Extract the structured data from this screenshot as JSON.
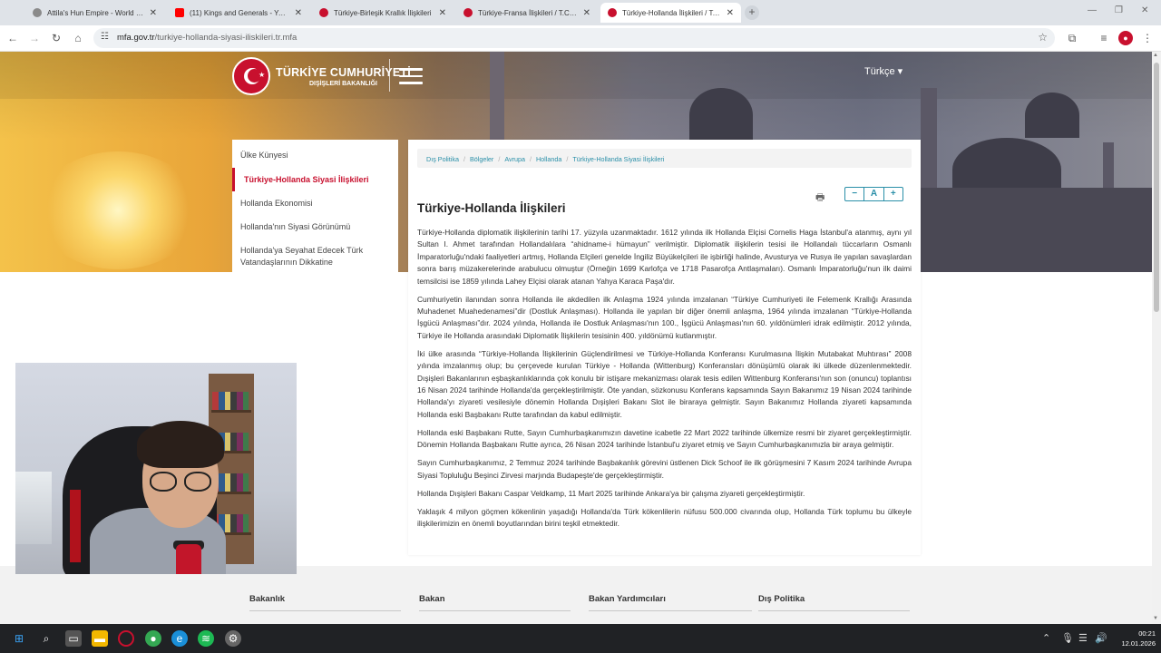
{
  "browser": {
    "tabs": [
      {
        "title": "Attila's Hun Empire - World His",
        "icon": "globe-icon",
        "color": "#8a8a8a",
        "active": false
      },
      {
        "title": "(11) Kings and Generals - YouTube",
        "icon": "youtube-icon",
        "color": "#ff0000",
        "active": false
      },
      {
        "title": "Türkiye-Birleşik Krallık İlişkileri",
        "icon": "mfa-icon",
        "color": "#c8102e",
        "active": false
      },
      {
        "title": "Türkiye-Fransa İlişkileri / T.C. D",
        "icon": "mfa-icon",
        "color": "#c8102e",
        "active": false
      },
      {
        "title": "Türkiye-Hollanda İlişkileri / T.C.",
        "icon": "mfa-icon",
        "color": "#c8102e",
        "active": true
      }
    ],
    "url_host": "mfa.gov.tr",
    "url_path": "/turkiye-hollanda-siyasi-iliskileri.tr.mfa"
  },
  "header": {
    "logo_line1": "TÜRKİYE CUMHURİYETİ",
    "logo_line2": "DIŞİŞLERİ BAKANLIĞI",
    "language": "Türkçe ▾"
  },
  "sidebar": {
    "items": [
      {
        "label": "Ülke Künyesi",
        "active": false
      },
      {
        "label": "Türkiye-Hollanda Siyasi İlişkileri",
        "active": true
      },
      {
        "label": "Hollanda Ekonomisi",
        "active": false
      },
      {
        "label": "Hollanda'nın Siyasi Görünümü",
        "active": false
      },
      {
        "label": "Hollanda'ya Seyahat Edecek Türk Vatandaşlarının Dikkatine",
        "active": false
      }
    ]
  },
  "breadcrumb": [
    "Dış Politika",
    "Bölgeler",
    "Avrupa",
    "Hollanda",
    "Türkiye-Hollanda Siyasi İlişkileri"
  ],
  "tools": {
    "decrease": "−",
    "reset": "A",
    "increase": "+"
  },
  "article": {
    "title": "Türkiye-Hollanda İlişkileri",
    "paragraphs": [
      "Türkiye-Hollanda diplomatik ilişkilerinin tarihi 17. yüzyıla uzanmaktadır. 1612 yılında ilk Hollanda Elçisi Cornelis Haga İstanbul'a atanmış, aynı yıl Sultan I. Ahmet tarafından Hollandalılara “ahidname-i hümayun” verilmiştir. Diplomatik ilişkilerin tesisi ile Hollandalı tüccarların Osmanlı İmparatorluğu'ndaki faaliyetleri artmış, Hollanda Elçileri genelde İngiliz Büyükelçileri ile işbirliği halinde, Avusturya ve Rusya ile yapılan savaşlardan sonra barış müzakerelerinde arabulucu olmuştur (Örneğin 1699 Karlofça ve 1718 Pasarofça Antlaşmaları). Osmanlı İmparatorluğu'nun ilk daimi temsilcisi ise 1859 yılında Lahey Elçisi olarak atanan Yahya Karaca Paşa'dır.",
      "Cumhuriyetin ilanından sonra Hollanda ile akdedilen ilk Anlaşma 1924 yılında imzalanan “Türkiye Cumhuriyeti ile Felemenk Krallığı Arasında Muhadenet Muahedenamesi”dir (Dostluk Anlaşması). Hollanda ile yapılan bir diğer önemli anlaşma, 1964 yılında imzalanan “Türkiye-Hollanda İşgücü Anlaşması”dır. 2024 yılında, Hollanda ile Dostluk Anlaşması'nın 100., İşgücü Anlaşması'nın 60. yıldönümleri idrak edilmiştir. 2012 yılında, Türkiye ile Hollanda arasındaki Diplomatik İlişkilerin tesisinin 400. yıldönümü kutlanmıştır.",
      "İki ülke arasında “Türkiye-Hollanda İlişkilerinin Güçlendirilmesi ve Türkiye-Hollanda Konferansı Kurulmasına İlişkin Mutabakat Muhtırası” 2008 yılında imzalanmış olup; bu çerçevede kurulan Türkiye - Hollanda (Wittenburg) Konferansları dönüşümlü olarak iki ülkede düzenlenmektedir. Dışişleri Bakanlarının eşbaşkanlıklarında çok konulu bir istişare mekanizması olarak tesis edilen Wittenburg Konferansı'nın son (onuncu) toplantısı 16 Nisan 2024 tarihinde Hollanda'da gerçekleştirilmiştir. Öte yandan, sözkonusu Konferans kapsamında Sayın Bakanımız 19 Nisan 2024 tarihinde Hollanda'yı ziyareti vesilesiyle dönemin Hollanda Dışişleri Bakanı Slot ile biraraya gelmiştir. Sayın Bakanımız Hollanda ziyareti kapsamında Hollanda eski Başbakanı Rutte tarafından da kabul edilmiştir.",
      "Hollanda eski Başbakanı Rutte, Sayın Cumhurbaşkanımızın davetine icabetle 22 Mart 2022 tarihinde ülkemize resmi bir ziyaret gerçekleştirmiştir. Dönemin Hollanda Başbakanı Rutte ayrıca, 26 Nisan 2024 tarihinde İstanbul'u ziyaret etmiş ve Sayın Cumhurbaşkanımızla bir araya gelmiştir.",
      "Sayın Cumhurbaşkanımız, 2 Temmuz 2024 tarihinde Başbakanlık görevini üstlenen Dick Schoof ile ilk görüşmesini 7 Kasım 2024 tarihinde Avrupa Siyasi Topluluğu Beşinci Zirvesi marjında Budapeşte'de gerçekleştirmiştir.",
      "Hollanda Dışişleri Bakanı Caspar Veldkamp, 11 Mart 2025 tarihinde Ankara'ya bir çalışma ziyareti gerçekleştirmiştir.",
      "Yaklaşık 4 milyon göçmen kökenlinin yaşadığı Hollanda'da Türk kökenlilerin nüfusu 500.000 civarında olup, Hollanda Türk toplumu bu ülkeyle ilişkilerimizin en önemli boyutlarından birini teşkil etmektedir."
    ]
  },
  "footer": {
    "columns": [
      "Bakanlık",
      "Bakan",
      "Bakan Yardımcıları",
      "Dış Politika"
    ]
  },
  "taskbar": {
    "time": "00:21",
    "date": "12.01.2026"
  },
  "colors": {
    "accent": "#c8102e",
    "link": "#2a8fa8"
  }
}
